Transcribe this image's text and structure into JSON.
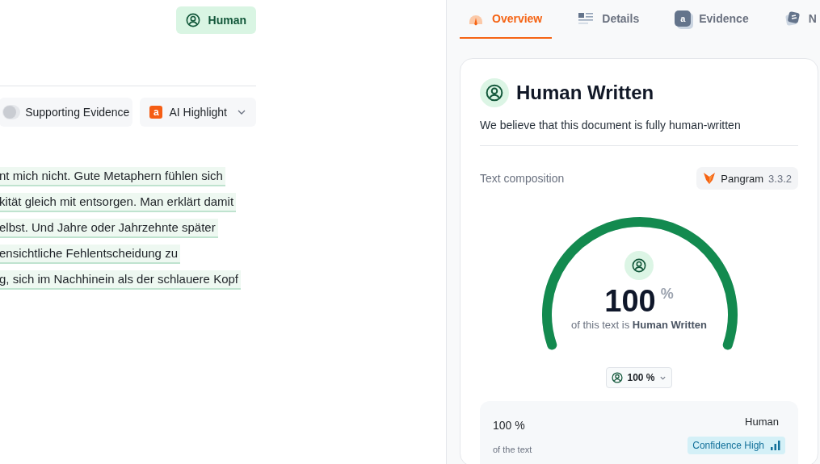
{
  "header_badge": {
    "label": "Human"
  },
  "toolbar": {
    "supporting_evidence": {
      "label": "Supporting Evidence",
      "on": false
    },
    "ai_highlight": {
      "label": "AI Highlight",
      "icon_text": "a"
    }
  },
  "text_lines": [
    {
      "text": "nt mich nicht. Gute Metaphern fühlen sich",
      "highlighted": true
    },
    {
      "text": "kität gleich mit entsorgen. Man erklärt damit",
      "highlighted": true
    },
    {
      "text": "elbst. Und Jahre oder Jahrzehnte später",
      "highlighted": true
    },
    {
      "text": "ensichtliche Fehlentscheidung zu",
      "highlighted": true
    },
    {
      "text": "g, sich im Nachhinein als der schlauere Kopf",
      "highlighted": true
    }
  ],
  "tabs": [
    {
      "kind": "overview",
      "label": "Overview",
      "selected": true
    },
    {
      "kind": "details",
      "label": "Details",
      "selected": false
    },
    {
      "kind": "evidence",
      "label": "Evidence",
      "icon_text": "a",
      "selected": false
    },
    {
      "kind": "notes",
      "label": "N",
      "selected": false
    }
  ],
  "result": {
    "title": "Human Written",
    "description": "We believe that this document is fully human-written",
    "composition_label": "Text composition",
    "model": {
      "name": "Pangram",
      "version": "3.3.2"
    },
    "gauge": {
      "level": 1,
      "value": "100",
      "unit": "%",
      "caption": "of this text is **Human Written**"
    },
    "selector": {
      "label": "100 %"
    },
    "breakdown": {
      "percent": "100 %",
      "caption": "of the text",
      "category": "Human",
      "confidence": "Confidence High"
    }
  }
}
